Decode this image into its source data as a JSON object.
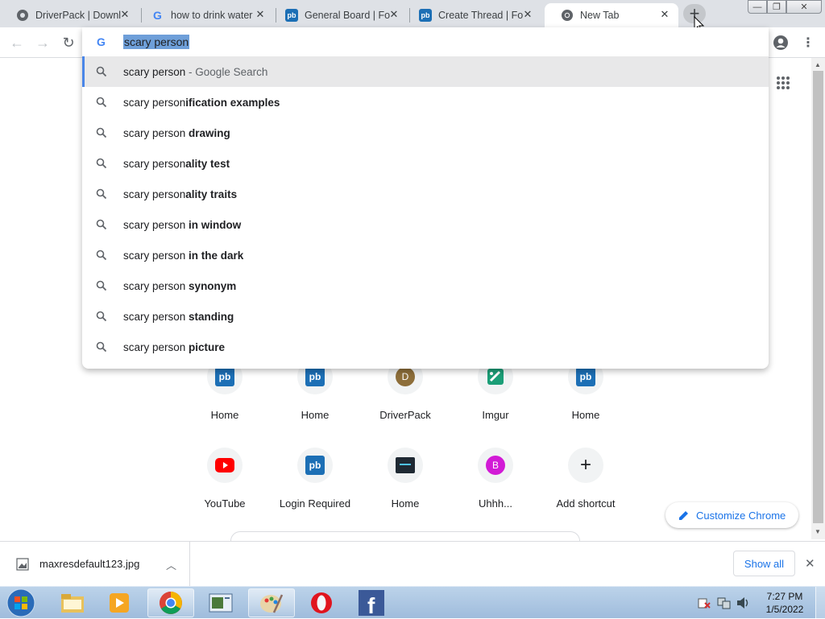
{
  "tabs": [
    {
      "title": "DriverPack | Downl",
      "icon": "driverpack-icon"
    },
    {
      "title": "how to drink water",
      "icon": "google-icon"
    },
    {
      "title": "General Board | For",
      "icon": "pb-icon"
    },
    {
      "title": "Create Thread | For",
      "icon": "pb-icon"
    },
    {
      "title": "New Tab",
      "icon": "chrome-icon",
      "active": true
    }
  ],
  "omnibox": {
    "text": "scary person",
    "suggestions": [
      {
        "typed": "scary person",
        "completion": "",
        "suffix": " - Google Search"
      },
      {
        "typed": "scary person",
        "completion": "ification examples"
      },
      {
        "typed": "scary person",
        "completion": " drawing"
      },
      {
        "typed": "scary person",
        "completion": "ality test"
      },
      {
        "typed": "scary person",
        "completion": "ality traits"
      },
      {
        "typed": "scary person",
        "completion": " in window"
      },
      {
        "typed": "scary person",
        "completion": " in the dark"
      },
      {
        "typed": "scary person",
        "completion": " synonym"
      },
      {
        "typed": "scary person",
        "completion": " standing"
      },
      {
        "typed": "scary person",
        "completion": " picture"
      }
    ]
  },
  "shortcuts": {
    "row1": [
      {
        "label": "Home",
        "icon": "pb-icon"
      },
      {
        "label": "Home",
        "icon": "pb-icon"
      },
      {
        "label": "DriverPack",
        "icon": "letter-d-icon",
        "letter": "D"
      },
      {
        "label": "Imgur",
        "icon": "imgur-icon"
      },
      {
        "label": "Home",
        "icon": "pb-icon"
      }
    ],
    "row2": [
      {
        "label": "YouTube",
        "icon": "youtube-icon"
      },
      {
        "label": "Login Required",
        "icon": "pb-icon"
      },
      {
        "label": "Home",
        "icon": "gb-icon"
      },
      {
        "label": "Uhhh...",
        "icon": "letter-b-icon",
        "letter": "B"
      },
      {
        "label": "Add shortcut",
        "icon": "plus-icon"
      }
    ]
  },
  "customize_label": "Customize Chrome",
  "download": {
    "filename": "maxresdefault123.jpg",
    "show_all": "Show all"
  },
  "clock": {
    "time": "7:27 PM",
    "date": "1/5/2022"
  },
  "colors": {
    "accent": "#1a73e8",
    "selection": "#6e9fd9",
    "highlight_row": "#e8e8e9"
  }
}
